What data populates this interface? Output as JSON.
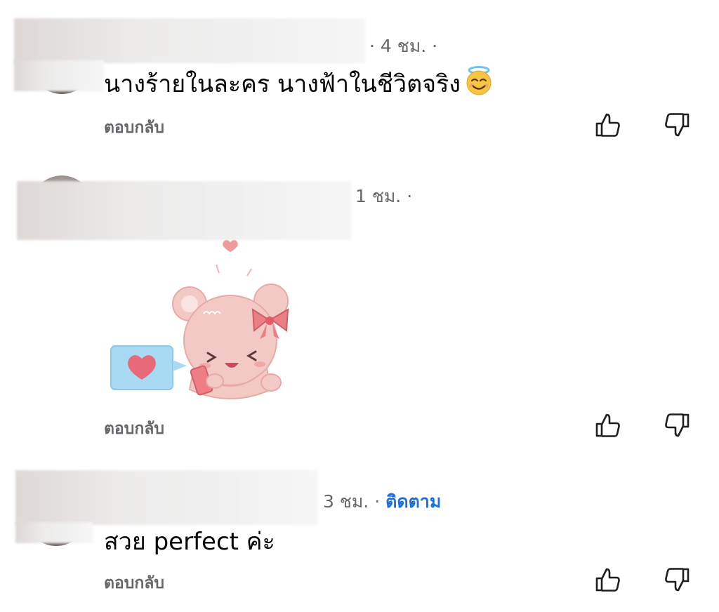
{
  "comments": [
    {
      "time": "· 4 ชม. ·",
      "text": "นางร้ายในละคร นางฟ้าในชีวิตจริง",
      "emoji_icon": "smiling-face-with-halo",
      "reply_label": "ตอบกลับ"
    },
    {
      "time": "1 ชม. ·",
      "sticker": "pink-bear-heart-phone-sticker",
      "reply_label": "ตอบกลับ"
    },
    {
      "time": "3 ชม. ·",
      "follow_label": "ติดตาม",
      "text": "สวย perfect ค่ะ",
      "reply_label": "ตอบกลับ"
    }
  ],
  "icons": {
    "upvote": "thumbs-up-outline-icon",
    "downvote": "thumbs-down-outline-icon"
  },
  "colors": {
    "meta_text": "#65676b",
    "follow_link": "#1b6fe0",
    "body_text": "#050505",
    "sticker_pink": "#f3c9c6",
    "sticker_blue": "#9fd3ef"
  }
}
